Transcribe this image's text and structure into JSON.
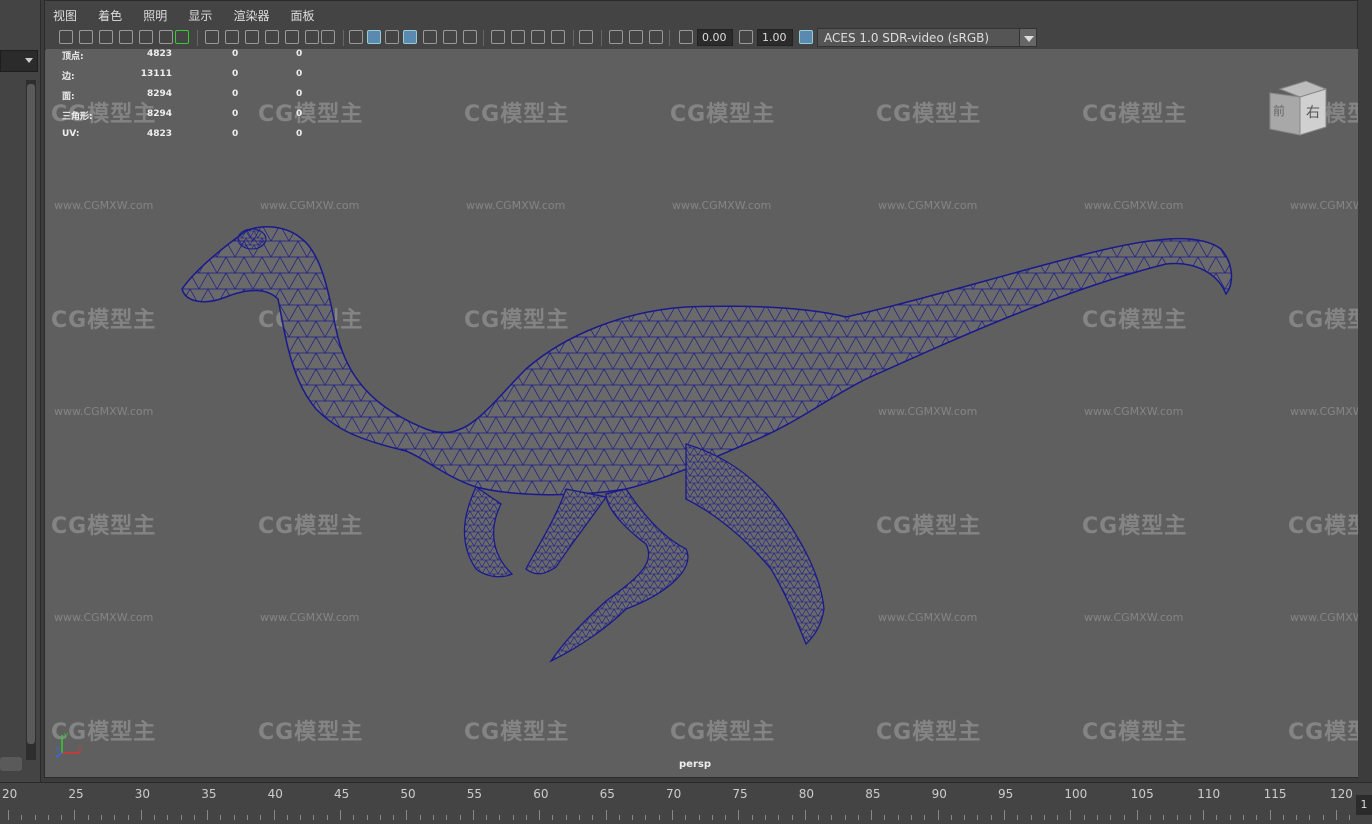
{
  "menu": [
    "视图",
    "着色",
    "照明",
    "显示",
    "渲染器",
    "面板"
  ],
  "toolbar": {
    "exposure": "0.00",
    "gamma": "1.00",
    "colorspace": "ACES 1.0 SDR-video (sRGB)"
  },
  "hud": [
    {
      "label": "顶点:",
      "v1": "4823",
      "v2": "0",
      "v3": "0"
    },
    {
      "label": "边:",
      "v1": "13111",
      "v2": "0",
      "v3": "0"
    },
    {
      "label": "面:",
      "v1": "8294",
      "v2": "0",
      "v3": "0"
    },
    {
      "label": "三角形:",
      "v1": "8294",
      "v2": "0",
      "v3": "0"
    },
    {
      "label": "UV:",
      "v1": "4823",
      "v2": "0",
      "v3": "0"
    }
  ],
  "viewcube": {
    "front": "前",
    "right": "右"
  },
  "camera_label": "persp",
  "axis": {
    "x": "x",
    "y": "y",
    "z": "z"
  },
  "timeline": {
    "ticks": [
      "20",
      "25",
      "30",
      "35",
      "40",
      "45",
      "50",
      "55",
      "60",
      "65",
      "70",
      "75",
      "80",
      "85",
      "90",
      "95",
      "100",
      "105",
      "110",
      "115",
      "120"
    ],
    "current_frame": "1"
  },
  "colors": {
    "wireframe": "#1a1a8c",
    "viewport_bg": "#5f5f5f",
    "ui_bg": "#444444"
  }
}
